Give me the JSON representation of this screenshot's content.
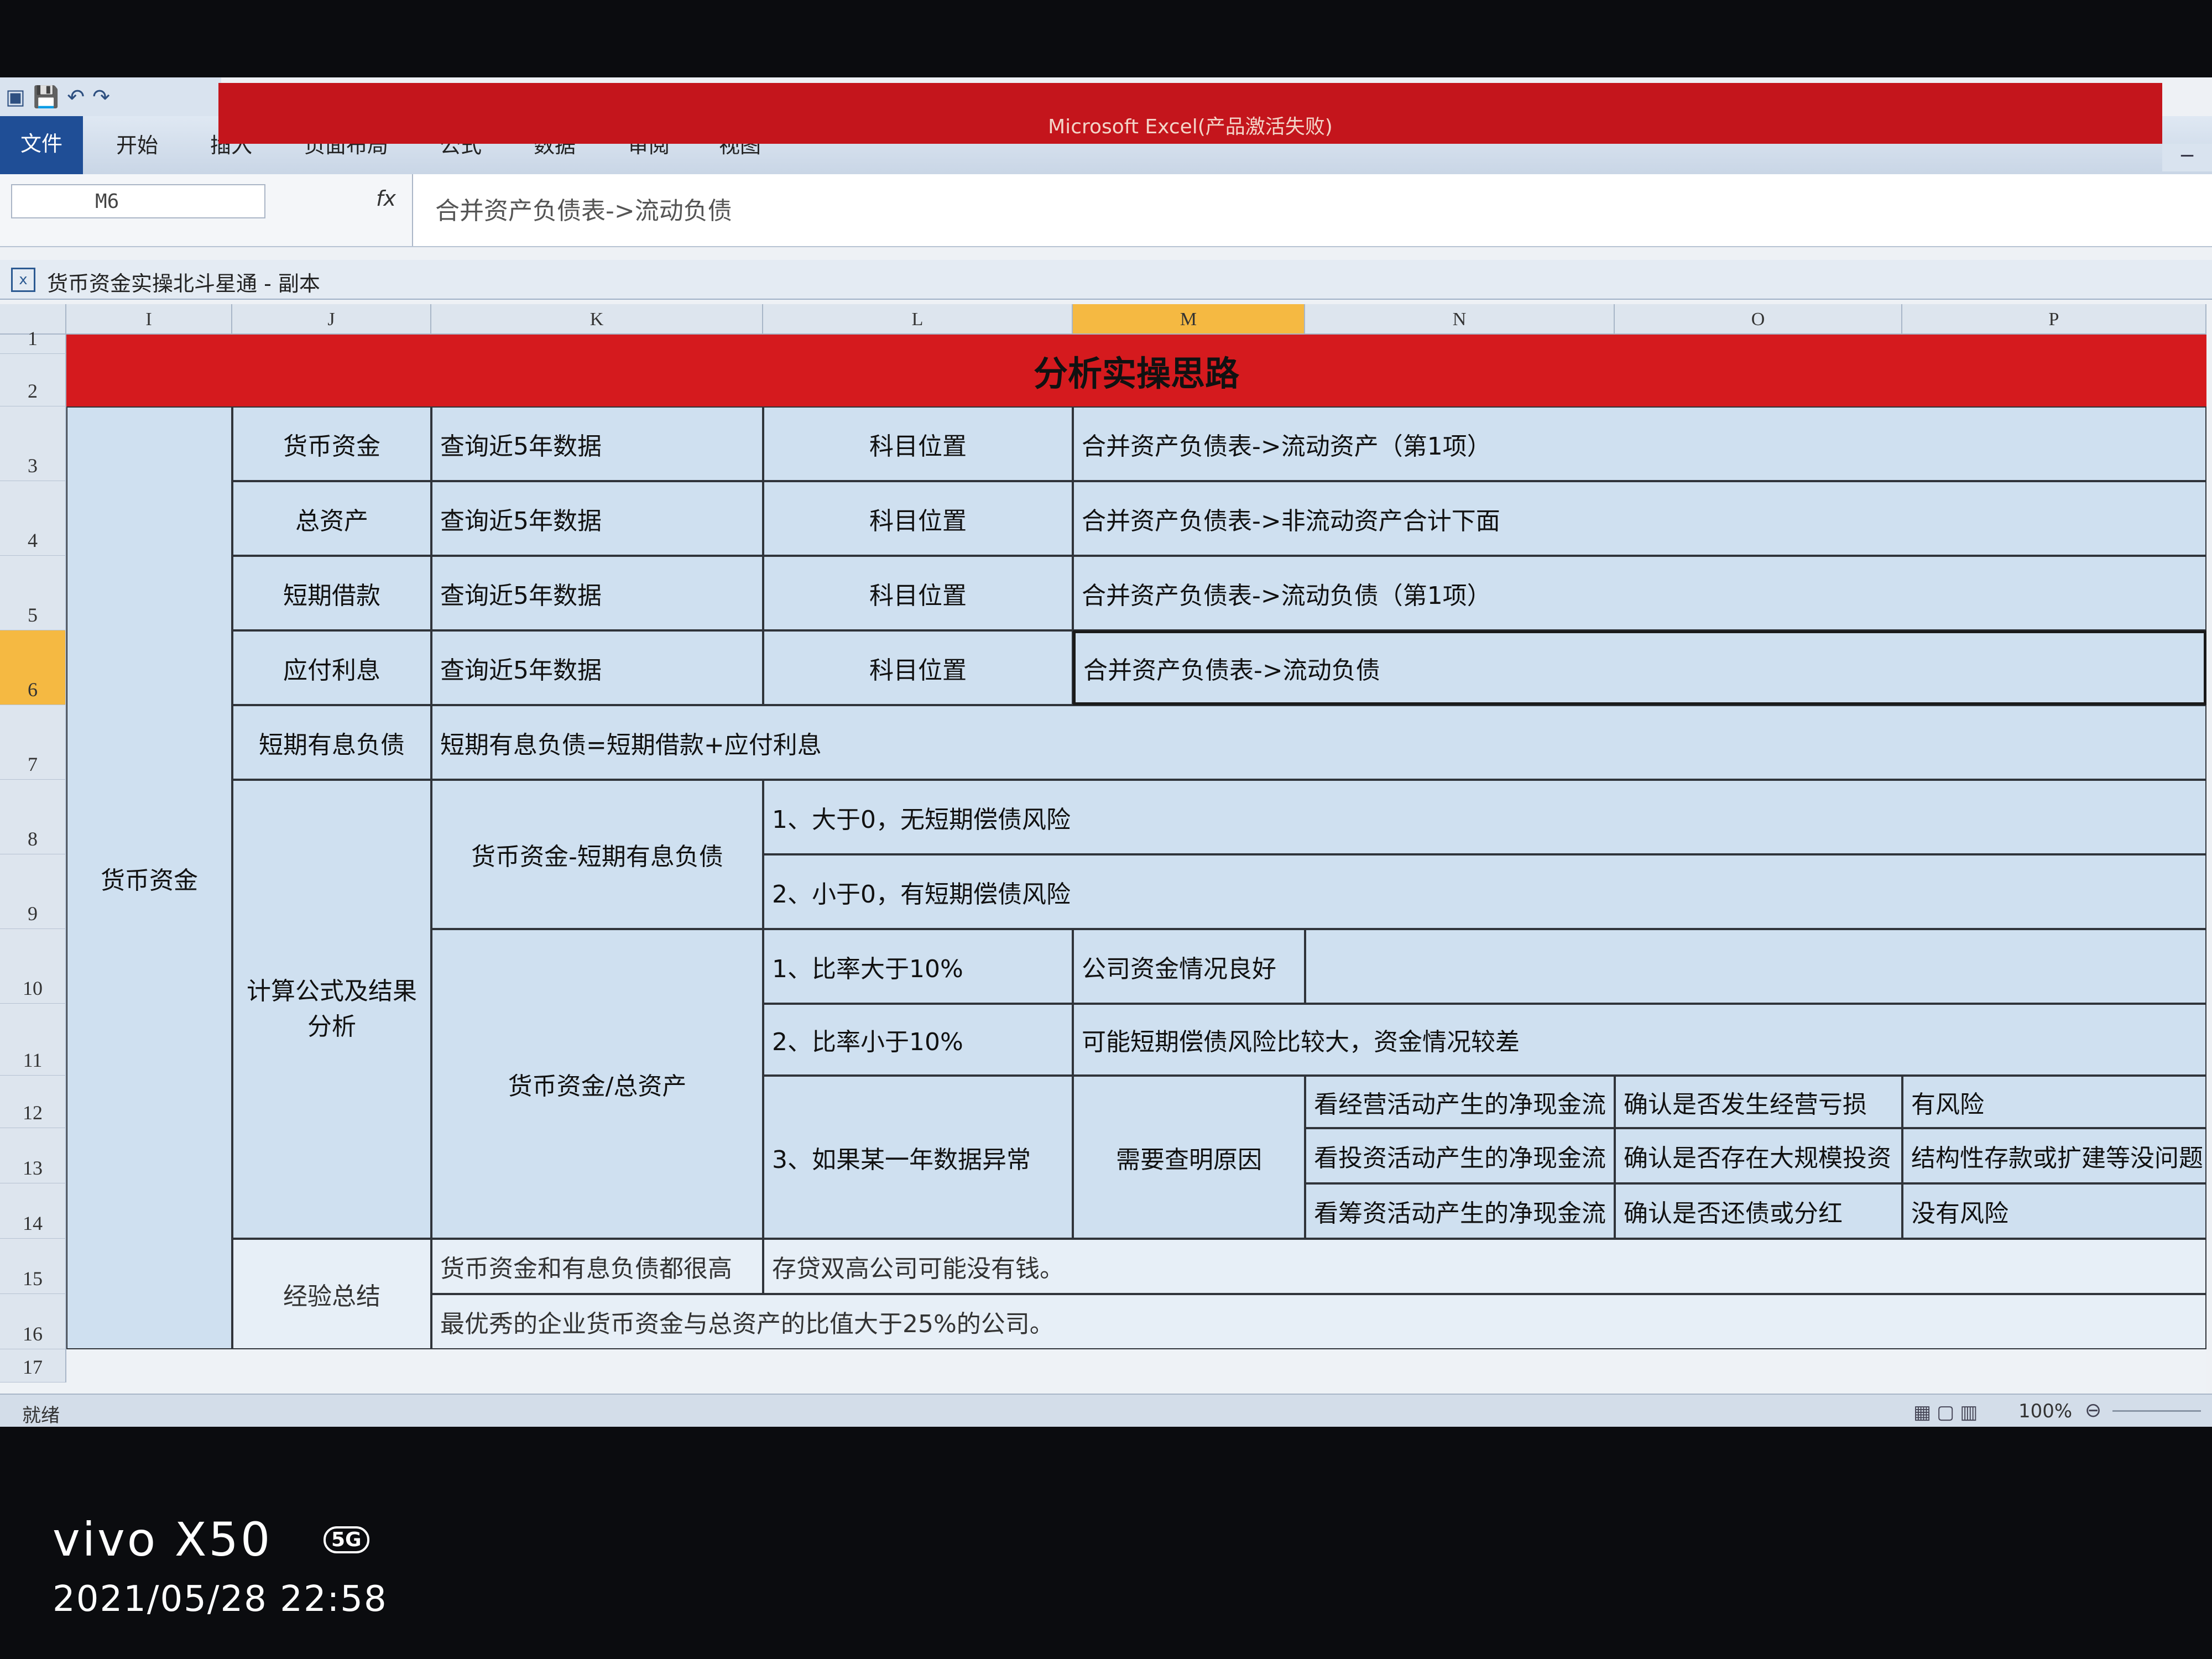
{
  "window": {
    "title": "Microsoft Excel(产品激活失败)",
    "minimize_glyph": "−"
  },
  "quick_access": {
    "icons": [
      "excel-icon",
      "save-icon",
      "undo-icon",
      "redo-icon"
    ],
    "glyphs": [
      "▣",
      "💾",
      "↶",
      "↷"
    ]
  },
  "ribbon": {
    "tabs": [
      "文件",
      "开始",
      "插入",
      "页面布局",
      "公式",
      "数据",
      "审阅",
      "视图"
    ]
  },
  "formula_bar": {
    "name_box": "M6",
    "fx": "fx",
    "value": "合并资产负债表->流动负债"
  },
  "workbook": {
    "name": "货币资金实操北斗星通 - 副本"
  },
  "columns": [
    "I",
    "J",
    "K",
    "L",
    "M",
    "N",
    "O",
    "P"
  ],
  "selected_column": "M",
  "rows": [
    "1",
    "2",
    "3",
    "4",
    "5",
    "6",
    "7",
    "8",
    "9",
    "10",
    "11",
    "12",
    "13",
    "14",
    "15",
    "16",
    "17"
  ],
  "selected_row": "6",
  "sheet": {
    "banner": "分析实操思路",
    "group": "货币资金",
    "items": [
      {
        "name": "货币资金",
        "query": "查询近5年数据",
        "label": "科目位置",
        "location": "合并资产负债表->流动资产（第1项）"
      },
      {
        "name": "总资产",
        "query": "查询近5年数据",
        "label": "科目位置",
        "location": "合并资产负债表->非流动资产合计下面"
      },
      {
        "name": "短期借款",
        "query": "查询近5年数据",
        "label": "科目位置",
        "location": "合并资产负债表->流动负债（第1项）"
      },
      {
        "name": "应付利息",
        "query": "查询近5年数据",
        "label": "科目位置",
        "location": "合并资产负债表->流动负债"
      }
    ],
    "short_debt": {
      "name": "短期有息负债",
      "formula": "短期有息负债=短期借款+应付利息"
    },
    "calc_label": "计算公式及结果分析",
    "calc1": {
      "formula": "货币资金-短期有息负债",
      "r1": "1、大于0，无短期偿债风险",
      "r2": "2、小于0，有短期偿债风险"
    },
    "calc2": {
      "formula": "货币资金/总资产",
      "r1": "1、比率大于10%",
      "r1_note": "公司资金情况良好",
      "r2": "2、比率小于10%",
      "r2_note": "可能短期偿债风险比较大，资金情况较差",
      "r3": "3、如果某一年数据异常",
      "r3_note": "需要查明原因",
      "checks": [
        {
          "flow": "看经营活动产生的净现金流",
          "confirm": "确认是否发生经营亏损",
          "result": "有风险"
        },
        {
          "flow": "看投资活动产生的净现金流",
          "confirm": "确认是否存在大规模投资",
          "result": "结构性存款或扩建等没问题"
        },
        {
          "flow": "看筹资活动产生的净现金流",
          "confirm": "确认是否还债或分红",
          "result": "没有风险"
        }
      ]
    },
    "summary": {
      "label": "经验总结",
      "r1a": "货币资金和有息负债都很高",
      "r1b": "存贷双高公司可能没有钱。",
      "r2": "最优秀的企业货币资金与总资产的比值大于25%的公司。"
    }
  },
  "status_bar": {
    "ready": "就绪",
    "zoom": "100%",
    "views": "▦▢▥",
    "zoom_minus": "⊖"
  },
  "watermark": {
    "device": "vivo X50",
    "badge": "5G",
    "datetime": "2021/05/28 22:58"
  }
}
